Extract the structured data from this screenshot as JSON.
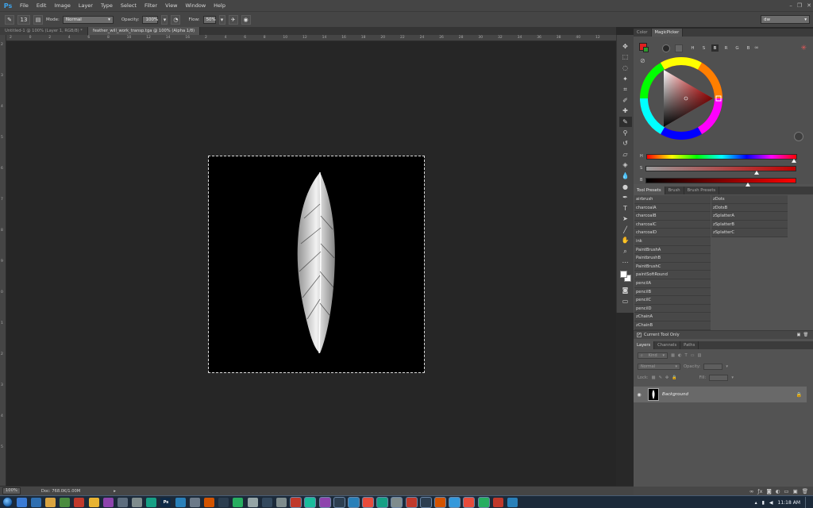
{
  "app": {
    "logo": "Ps"
  },
  "menu": [
    "File",
    "Edit",
    "Image",
    "Layer",
    "Type",
    "Select",
    "Filter",
    "View",
    "Window",
    "Help"
  ],
  "options": {
    "brush_size": "13",
    "mode_label": "Mode:",
    "mode_value": "Normal",
    "opacity_label": "Opacity:",
    "opacity_value": "100%",
    "flow_label": "Flow:",
    "flow_value": "50%",
    "workspace": "dw"
  },
  "tabs": [
    {
      "label": "Untitled-1 @ 100% (Layer 1, RGB/8) *",
      "active": false
    },
    {
      "label": "feather_will_work_transp.tga @ 100% (Alpha 1/8)",
      "active": true
    }
  ],
  "ruler_top": [
    "2",
    "0",
    "2",
    "4",
    "6",
    "8",
    "10",
    "12",
    "14",
    "16",
    "2",
    "4",
    "6",
    "8",
    "10",
    "12",
    "14",
    "16",
    "18",
    "20",
    "22",
    "24",
    "26",
    "28",
    "30",
    "32",
    "34",
    "36",
    "38",
    "40",
    "12"
  ],
  "ruler_left": [
    "2",
    "3",
    "4",
    "5",
    "6",
    "7",
    "8",
    "9",
    "0",
    "1",
    "2",
    "3",
    "4",
    "5"
  ],
  "status": {
    "zoom": "100%",
    "doc": "Doc: 768.0K/1.00M"
  },
  "color_panel": {
    "tabs": [
      "Color",
      "MagicPicker"
    ],
    "modes": [
      "H",
      "S",
      "B",
      "R",
      "G",
      "B"
    ],
    "selected_mode": "B",
    "fg_color": "#e02020",
    "bg_color": "#2e9a2e",
    "sliders": [
      {
        "label": "H",
        "value": 0.985
      },
      {
        "label": "S",
        "value": 0.74
      },
      {
        "label": "B",
        "value": 0.68
      }
    ]
  },
  "presets_panel": {
    "tabs": [
      "Tool Presets",
      "Brush",
      "Brush Presets"
    ],
    "col1": [
      "airbrush",
      "charcoalA",
      "charcoalB",
      "charcoalC",
      "charcoalD",
      "ink",
      "PaintBrushA",
      "PaintbrushB",
      "PaintBrushC",
      "paintSoftRound",
      "pencilA",
      "pencilB",
      "pencilC",
      "pencilD",
      "zChainA",
      "zChainB"
    ],
    "col2": [
      "zDots",
      "zDotsB",
      "zSplatterA",
      "zSplatterB",
      "zSplatterC"
    ],
    "current_tool_only": "Current Tool Only"
  },
  "layers_panel": {
    "tabs": [
      "Layers",
      "Channels",
      "Paths"
    ],
    "kind": "Kind",
    "blend": "Normal",
    "opacity_label": "Opacity:",
    "lock_label": "Lock:",
    "fill_label": "Fill:",
    "layer_name": "Background"
  },
  "taskbar": {
    "apps": [
      {
        "label": "",
        "color": "#3a7bd5"
      },
      {
        "label": "",
        "color": "#2f6fb1"
      },
      {
        "label": "",
        "color": "#d9a441"
      },
      {
        "label": "",
        "color": "#4a8c3f"
      },
      {
        "label": "",
        "color": "#c0392b"
      },
      {
        "label": "",
        "color": "#e8b332"
      },
      {
        "label": "",
        "color": "#8e44ad"
      },
      {
        "label": "",
        "color": "#5d6d7e"
      },
      {
        "label": "",
        "color": "#7f8c8d"
      },
      {
        "label": "",
        "color": "#16a085"
      },
      {
        "label": "Ps",
        "color": "#0e2a47"
      },
      {
        "label": "",
        "color": "#2980b9"
      },
      {
        "label": "",
        "color": "#6c7a89"
      },
      {
        "label": "",
        "color": "#d35400"
      },
      {
        "label": "",
        "color": "#2c3e50"
      },
      {
        "label": "",
        "color": "#27ae60"
      },
      {
        "label": "",
        "color": "#95a5a6"
      },
      {
        "label": "",
        "color": "#34495e"
      },
      {
        "label": "",
        "color": "#7f8c8d"
      },
      {
        "label": "",
        "color": "#c0392b"
      },
      {
        "label": "",
        "color": "#1abc9c"
      },
      {
        "label": "",
        "color": "#8e44ad"
      },
      {
        "label": "",
        "color": "#2c3e50"
      },
      {
        "label": "",
        "color": "#2980b9"
      },
      {
        "label": "",
        "color": "#e74c3c"
      },
      {
        "label": "",
        "color": "#16a085"
      },
      {
        "label": "",
        "color": "#7f8c8d"
      },
      {
        "label": "",
        "color": "#c0392b"
      },
      {
        "label": "",
        "color": "#2c3e50"
      },
      {
        "label": "",
        "color": "#d35400"
      },
      {
        "label": "",
        "color": "#3498db"
      },
      {
        "label": "",
        "color": "#e74c3c"
      },
      {
        "label": "",
        "color": "#27ae60"
      },
      {
        "label": "",
        "color": "#c0392b"
      },
      {
        "label": "",
        "color": "#2980b9"
      }
    ],
    "time": "11:18 AM"
  }
}
